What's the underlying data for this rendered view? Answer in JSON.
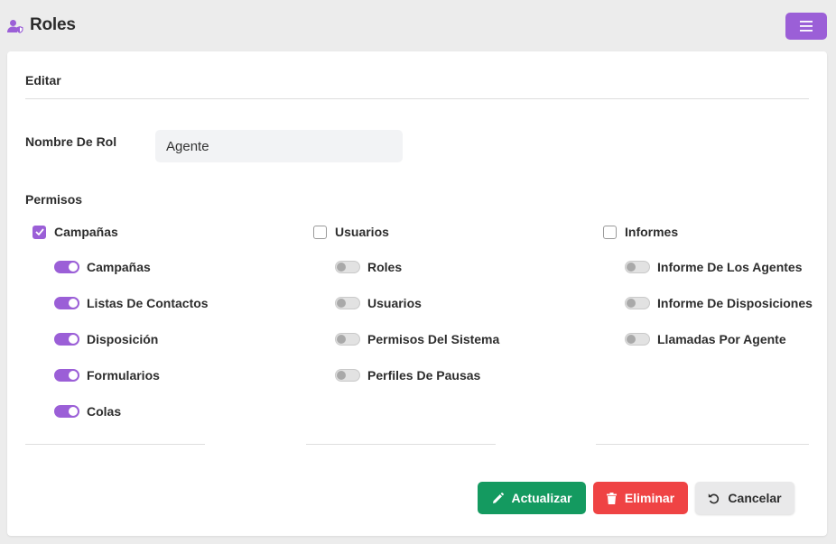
{
  "header": {
    "title": "Roles",
    "icon": "user-shield-icon",
    "menu_icon": "hamburger-menu-icon"
  },
  "form": {
    "card_title": "Editar",
    "role_name_label": "Nombre De Rol",
    "role_name_value": "Agente",
    "permissions_label": "Permisos"
  },
  "groups": [
    {
      "label": "Campañas",
      "checked": true,
      "items": [
        {
          "label": "Campañas",
          "on": true
        },
        {
          "label": "Listas De Contactos",
          "on": true
        },
        {
          "label": "Disposición",
          "on": true
        },
        {
          "label": "Formularios",
          "on": true
        },
        {
          "label": "Colas",
          "on": true
        }
      ]
    },
    {
      "label": "Usuarios",
      "checked": false,
      "items": [
        {
          "label": "Roles",
          "on": false
        },
        {
          "label": "Usuarios",
          "on": false
        },
        {
          "label": "Permisos Del Sistema",
          "on": false
        },
        {
          "label": "Perfiles De Pausas",
          "on": false
        }
      ]
    },
    {
      "label": "Informes",
      "checked": false,
      "items": [
        {
          "label": "Informe De Los Agentes",
          "on": false
        },
        {
          "label": "Informe De Disposiciones",
          "on": false
        },
        {
          "label": "Llamadas Por Agente",
          "on": false
        }
      ]
    }
  ],
  "actions": {
    "update_label": "Actualizar",
    "delete_label": "Eliminar",
    "cancel_label": "Cancelar"
  },
  "colors": {
    "accent": "#9b5fd7",
    "success": "#149a60",
    "danger": "#ef4344",
    "background": "#ececec"
  }
}
